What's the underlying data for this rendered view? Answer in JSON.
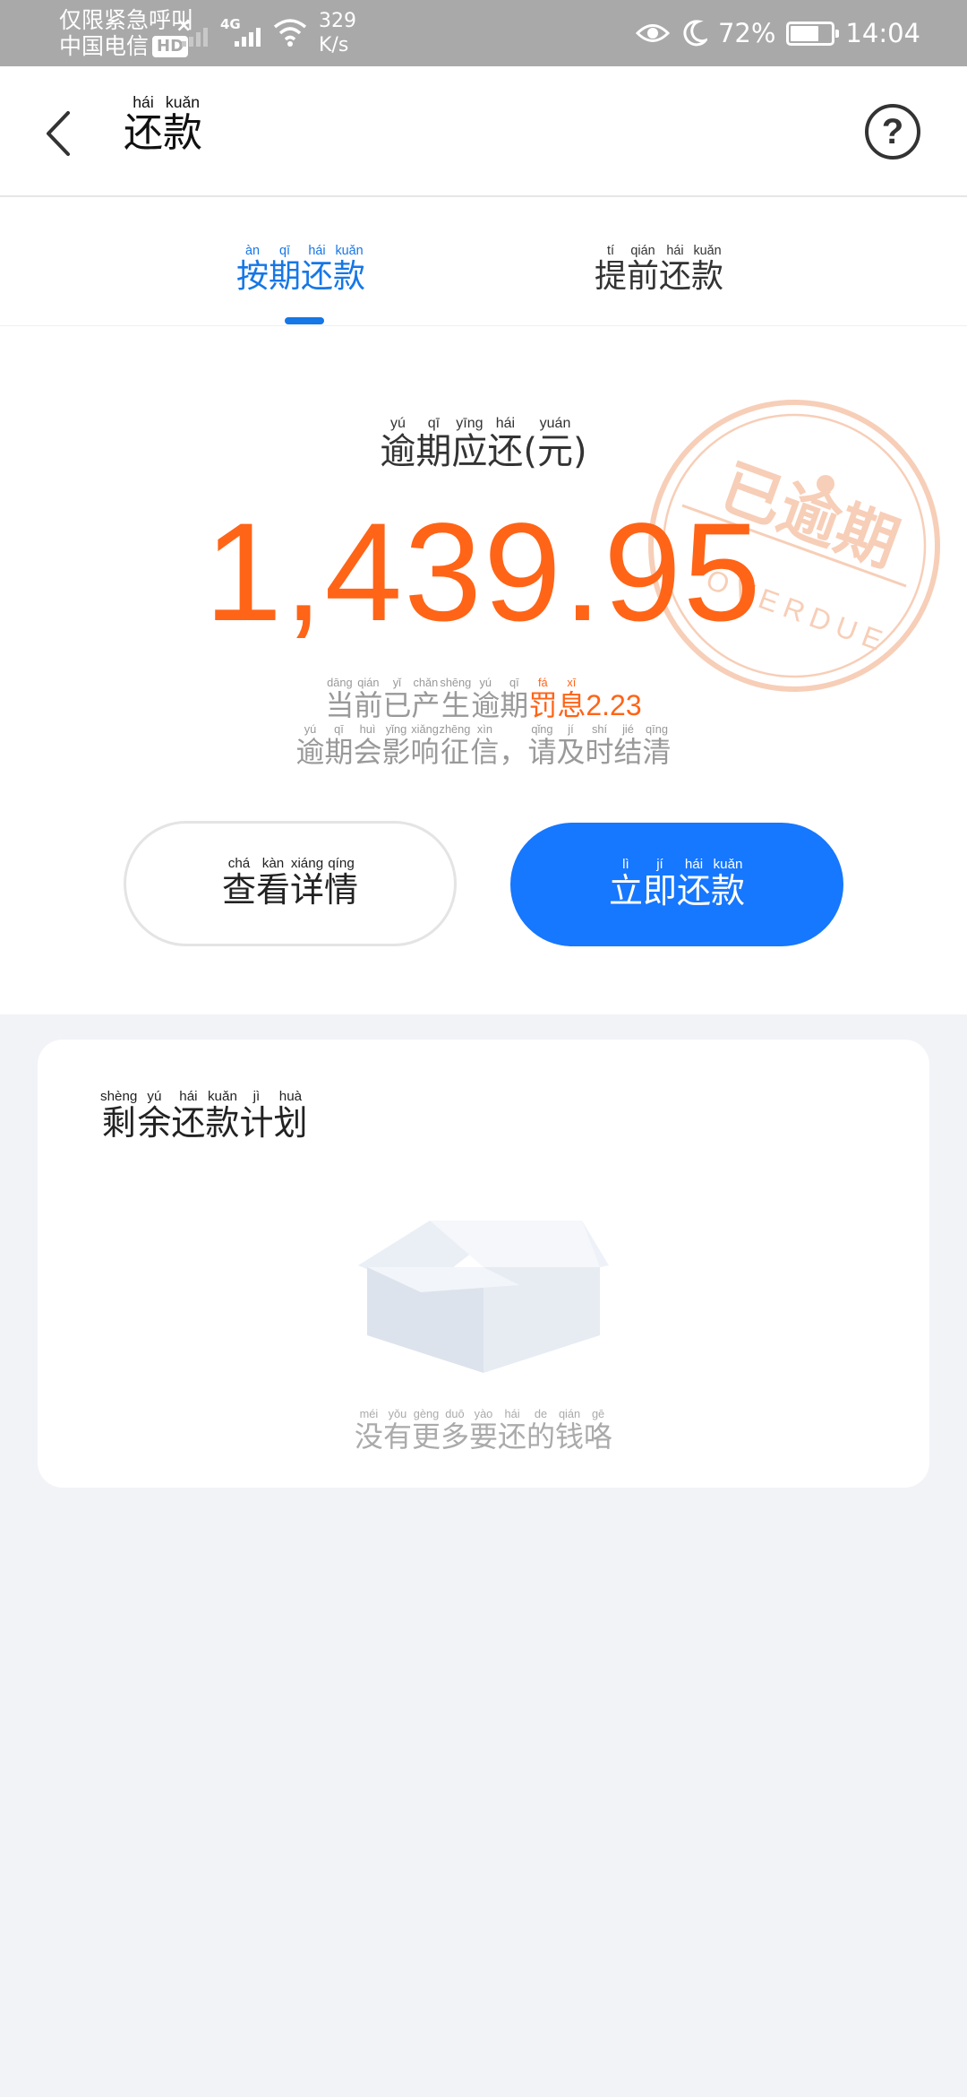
{
  "status_bar": {
    "carrier_line1": "仅限紧急呼叫",
    "carrier_line2": "中国电信",
    "hd_badge": "HD",
    "network": "4G",
    "speed_value": "329",
    "speed_unit": "K/s",
    "battery_percent": "72%",
    "battery_level": 0.72,
    "time": "14:04",
    "icons": [
      "x-icon",
      "signal-icon",
      "wifi-icon",
      "eye-icon",
      "moon-icon",
      "battery-icon"
    ]
  },
  "header": {
    "title": [
      {
        "char": "还",
        "py": "hái"
      },
      {
        "char": "款",
        "py": "kuǎn"
      }
    ],
    "back_icon": "chevron-left-icon",
    "help_icon": "help-circle-icon",
    "help_glyph": "?"
  },
  "tabs": [
    {
      "label": [
        {
          "char": "按",
          "py": "àn"
        },
        {
          "char": "期",
          "py": "qī"
        },
        {
          "char": "还",
          "py": "hái"
        },
        {
          "char": "款",
          "py": "kuǎn"
        }
      ],
      "active": true
    },
    {
      "label": [
        {
          "char": "提",
          "py": "tí"
        },
        {
          "char": "前",
          "py": "qián"
        },
        {
          "char": "还",
          "py": "hái"
        },
        {
          "char": "款",
          "py": "kuǎn"
        }
      ],
      "active": false
    }
  ],
  "summary": {
    "due_label": [
      {
        "char": "逾",
        "py": "yú"
      },
      {
        "char": "期",
        "py": "qī"
      },
      {
        "char": "应",
        "py": "yīng"
      },
      {
        "char": "还",
        "py": "hái"
      },
      {
        "char": "(",
        "py": ""
      },
      {
        "char": "元",
        "py": "yuán"
      },
      {
        "char": ")",
        "py": ""
      }
    ],
    "amount": "1,439.95",
    "amount_color": "#ff6417",
    "stamp": {
      "text": "已逾期",
      "subtext": "OVERDUE",
      "color": "#f4a57a"
    },
    "penalty_prefix": [
      {
        "char": "当",
        "py": "dāng"
      },
      {
        "char": "前",
        "py": "qián"
      },
      {
        "char": "已",
        "py": "yǐ"
      },
      {
        "char": "产",
        "py": "chǎn"
      },
      {
        "char": "生",
        "py": "shēng"
      },
      {
        "char": "逾",
        "py": "yú"
      },
      {
        "char": "期",
        "py": "qī"
      }
    ],
    "penalty_word": [
      {
        "char": "罚",
        "py": "fá"
      },
      {
        "char": "息",
        "py": "xī"
      }
    ],
    "penalty_amount": "2.23",
    "warning": [
      {
        "char": "逾",
        "py": "yú"
      },
      {
        "char": "期",
        "py": "qī"
      },
      {
        "char": "会",
        "py": "huì"
      },
      {
        "char": "影",
        "py": "yǐng"
      },
      {
        "char": "响",
        "py": "xiǎng"
      },
      {
        "char": "征",
        "py": "zhēng"
      },
      {
        "char": "信",
        "py": "xìn"
      },
      {
        "char": "，",
        "py": ""
      },
      {
        "char": "请",
        "py": "qǐng"
      },
      {
        "char": "及",
        "py": "jí"
      },
      {
        "char": "时",
        "py": "shí"
      },
      {
        "char": "结",
        "py": "jié"
      },
      {
        "char": "清",
        "py": "qīng"
      }
    ],
    "detail_button": [
      {
        "char": "查",
        "py": "chá"
      },
      {
        "char": "看",
        "py": "kàn"
      },
      {
        "char": "详",
        "py": "xiáng"
      },
      {
        "char": "情",
        "py": "qíng"
      }
    ],
    "pay_button": [
      {
        "char": "立",
        "py": "lì"
      },
      {
        "char": "即",
        "py": "jí"
      },
      {
        "char": "还",
        "py": "hái"
      },
      {
        "char": "款",
        "py": "kuǎn"
      }
    ],
    "accent_color": "#1677ff"
  },
  "plan": {
    "title": [
      {
        "char": "剩",
        "py": "shèng"
      },
      {
        "char": "余",
        "py": "yú"
      },
      {
        "char": "还",
        "py": "hái"
      },
      {
        "char": "款",
        "py": "kuǎn"
      },
      {
        "char": "计",
        "py": "jì"
      },
      {
        "char": "划",
        "py": "huà"
      }
    ],
    "empty_icon": "empty-box-icon",
    "empty_text": [
      {
        "char": "没",
        "py": "méi"
      },
      {
        "char": "有",
        "py": "yǒu"
      },
      {
        "char": "更",
        "py": "gèng"
      },
      {
        "char": "多",
        "py": "duō"
      },
      {
        "char": "要",
        "py": "yào"
      },
      {
        "char": "还",
        "py": "hái"
      },
      {
        "char": "的",
        "py": "de"
      },
      {
        "char": "钱",
        "py": "qián"
      },
      {
        "char": "咯",
        "py": "gē"
      }
    ]
  }
}
